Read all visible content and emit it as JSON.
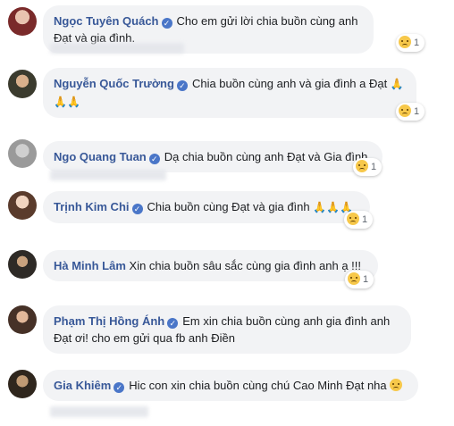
{
  "comments": [
    {
      "name": "Ngọc Tuyên Quách",
      "text": "Cho em gửi lời chia buồn cùng anh Đạt và gia đình.",
      "reaction_count": "1",
      "reaction_icon": "sad-face-icon"
    },
    {
      "name": "Nguyễn Quốc Trường",
      "text": "Chia buồn cùng anh và gia đình a Đạt",
      "emoji": "🙏 🙏🙏",
      "reaction_count": "1",
      "reaction_icon": "sad-face-icon"
    },
    {
      "name": "Ngo Quang Tuan",
      "text": "Dạ chia buồn cùng anh Đạt và Gia đình.",
      "reaction_count": "1",
      "reaction_icon": "sad-face-icon"
    },
    {
      "name": "Trịnh Kim Chi",
      "text": "Chia buồn cùng Đạt và gia đình",
      "emoji": "🙏🙏🙏",
      "reaction_count": "1",
      "reaction_icon": "sad-face-icon"
    },
    {
      "name": "Hà Minh Lâm",
      "text": "Xin chia buồn sâu sắc cùng gia đình anh ạ !!!",
      "reaction_count": "1",
      "reaction_icon": "sad-face-icon"
    },
    {
      "name": "Phạm Thị Hồng Ánh",
      "text": "Em xin chia buồn cùng anh gia đình anh Đạt ơi! cho em gửi qua fb anh Điền"
    },
    {
      "name": "Gia Khiêm",
      "text": "Hic con xin chia buồn cùng chú Cao Minh Đạt nha"
    }
  ],
  "colors": {
    "name": "#385898",
    "bubble": "#f2f3f5",
    "verified": "#4a76c8"
  }
}
